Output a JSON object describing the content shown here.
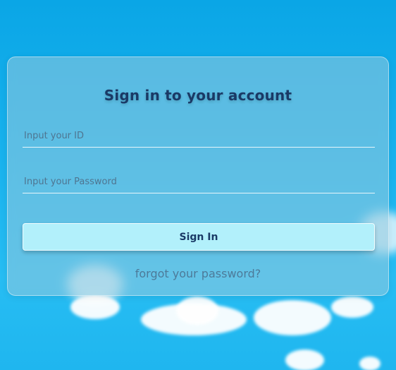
{
  "login": {
    "title": "Sign in to your account",
    "id_placeholder": "Input your ID",
    "password_placeholder": "Input your Password",
    "signin_label": "Sign In",
    "forgot_label": "forgot your password?"
  },
  "colors": {
    "sky": "#1ab3ee",
    "card": "#96c8dc",
    "button": "#b2f0fb",
    "title_text": "#1a3a66",
    "link_text": "#4d7a99"
  }
}
